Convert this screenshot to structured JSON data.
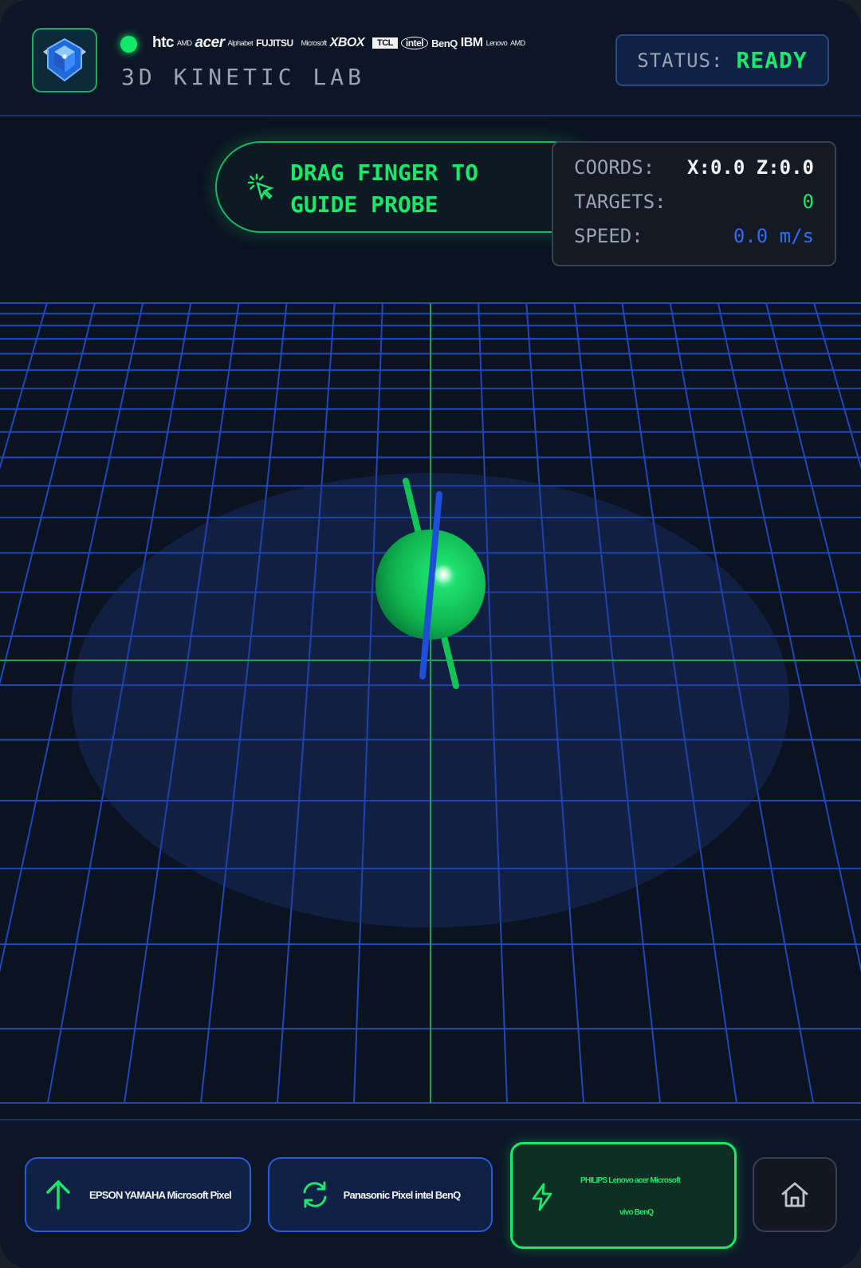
{
  "header": {
    "title": "3D KINETIC LAB",
    "brands": [
      "htc",
      "AMD",
      "acer",
      "Alphabet",
      "FUJITSU",
      "Microsoft",
      "XBOX",
      "TCL",
      "intel",
      "BenQ",
      "IBM",
      "Lenovo",
      "AMD"
    ],
    "status_label": "STATUS:",
    "status_value": "READY"
  },
  "hint": {
    "text": "DRAG FINGER TO GUIDE PROBE"
  },
  "telemetry": {
    "coords_label": "COORDS:",
    "coords_value": "X:0.0 Z:0.0",
    "targets_label": "TARGETS:",
    "targets_value": "0",
    "speed_label": "SPEED:",
    "speed_value": "0.0 m/s"
  },
  "controls": {
    "up_label": "EPSON YAMAHA Microsoft Pixel",
    "reset_label": "Panasonic Pixel intel BenQ",
    "boost_label_line1": "PHILIPS Lenovo acer Microsoft",
    "boost_label_line2": "vivo BenQ"
  },
  "icons": {
    "logo": "shield-crystal-icon",
    "hint": "pointer-click-icon",
    "up": "arrow-up-icon",
    "reset": "refresh-icon",
    "boost": "lightning-icon",
    "home": "home-icon"
  },
  "colors": {
    "accent_green": "#19e86b",
    "accent_blue": "#2f6bff",
    "grid": "#1f48b8",
    "background": "#0b1220"
  }
}
